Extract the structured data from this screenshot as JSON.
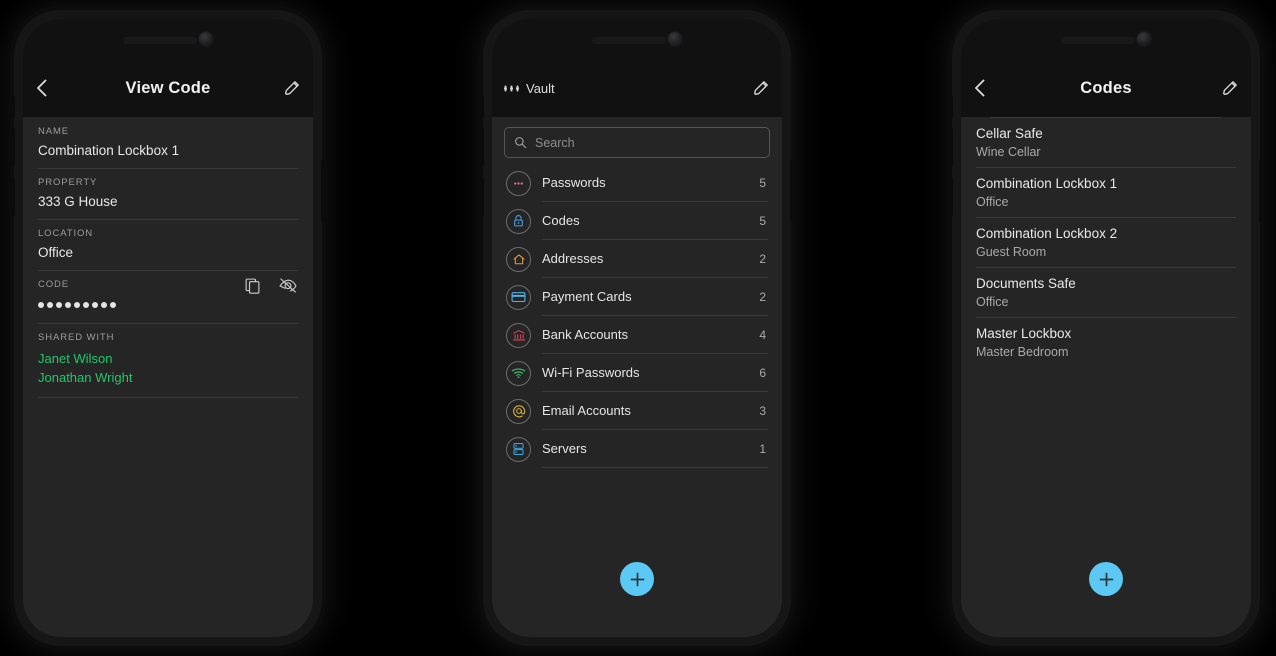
{
  "page": {
    "background": "#000000",
    "accent": "#5cc9f5",
    "screen_bg": "#252526",
    "header_bg": "#111112",
    "divider": "#3a3a3b",
    "shared_name_color": "#1fc76a"
  },
  "phone1": {
    "nav": {
      "back_icon": "chevron-left-icon",
      "title": "View Code",
      "edit_icon": "pencil-icon"
    },
    "fields": [
      {
        "label": "NAME",
        "value": "Combination Lockbox 1"
      },
      {
        "label": "PROPERTY",
        "value": "333 G House"
      },
      {
        "label": "LOCATION",
        "value": "Office"
      }
    ],
    "code_field": {
      "label": "CODE",
      "masked_value": "•••••••••",
      "mask_dot_count": 9,
      "copy_icon": "copy-icon",
      "reveal_icon": "eye-off-icon"
    },
    "shared": {
      "label": "SHARED WITH",
      "people": [
        "Janet Wilson",
        "Jonathan Wright"
      ]
    }
  },
  "phone2": {
    "nav": {
      "menu_icon": "three-dots-icon",
      "title": "Vault",
      "edit_icon": "pencil-icon"
    },
    "search": {
      "placeholder": "Search",
      "value": "",
      "icon": "search-icon"
    },
    "categories": [
      {
        "label": "Passwords",
        "count": "5",
        "icon": "dots-circle-icon",
        "color": "#e8708f"
      },
      {
        "label": "Codes",
        "count": "5",
        "icon": "lock-icon",
        "color": "#4d9de0"
      },
      {
        "label": "Addresses",
        "count": "2",
        "icon": "home-icon",
        "color": "#e09a3e"
      },
      {
        "label": "Payment Cards",
        "count": "2",
        "icon": "credit-card-icon",
        "color": "#4fb3e8"
      },
      {
        "label": "Bank Accounts",
        "count": "4",
        "icon": "bank-icon",
        "color": "#d8485c"
      },
      {
        "label": "Wi-Fi Passwords",
        "count": "6",
        "icon": "wifi-icon",
        "color": "#3fb96a"
      },
      {
        "label": "Email Accounts",
        "count": "3",
        "icon": "at-sign-icon",
        "color": "#d8b13a"
      },
      {
        "label": "Servers",
        "count": "1",
        "icon": "server-icon",
        "color": "#3fa3d8"
      }
    ],
    "fab": {
      "icon": "plus-icon",
      "label": "Add"
    }
  },
  "phone3": {
    "nav": {
      "back_icon": "chevron-left-icon",
      "title": "Codes",
      "edit_icon": "pencil-icon"
    },
    "items": [
      {
        "title": "Cellar Safe",
        "subtitle": "Wine Cellar"
      },
      {
        "title": "Combination Lockbox 1",
        "subtitle": "Office"
      },
      {
        "title": "Combination Lockbox 2",
        "subtitle": "Guest Room"
      },
      {
        "title": "Documents Safe",
        "subtitle": "Office"
      },
      {
        "title": "Master Lockbox",
        "subtitle": "Master Bedroom"
      }
    ],
    "fab": {
      "icon": "plus-icon",
      "label": "Add"
    }
  }
}
